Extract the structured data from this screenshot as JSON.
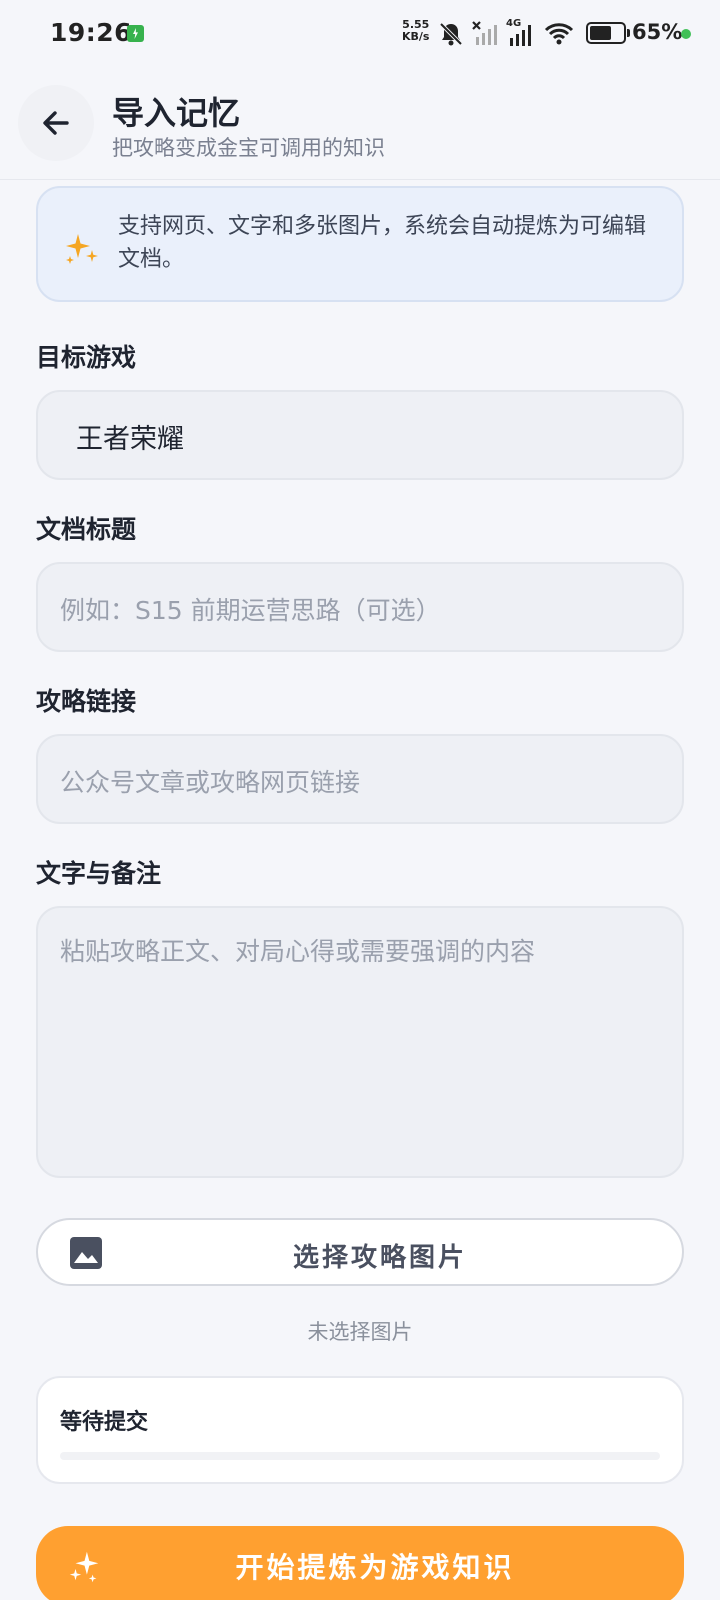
{
  "status_bar": {
    "time": "19:26",
    "net_speed_value": "5.55",
    "net_speed_unit": "KB/s",
    "network_type": "4G",
    "battery_percent": "65%",
    "battery_level": 0.65
  },
  "header": {
    "title": "导入记忆",
    "subtitle": "把攻略变成金宝可调用的知识"
  },
  "banner": {
    "text": "支持网页、文字和多张图片，系统会自动提炼为可编辑文档。",
    "icon": "sparkle-icon"
  },
  "form": {
    "game": {
      "label": "目标游戏",
      "value": "王者荣耀"
    },
    "doc_title": {
      "label": "文档标题",
      "placeholder": "例如：S15 前期运营思路（可选）"
    },
    "link": {
      "label": "攻略链接",
      "placeholder": "公众号文章或攻略网页链接"
    },
    "notes": {
      "label": "文字与备注",
      "placeholder": "粘贴攻略正文、对局心得或需要强调的内容"
    }
  },
  "image_select": {
    "button_label": "选择攻略图片",
    "icon": "image-icon",
    "status": "未选择图片"
  },
  "progress": {
    "title": "等待提交",
    "fraction": 0
  },
  "submit": {
    "label": "开始提炼为游戏知识",
    "icon": "sparkle-icon"
  },
  "colors": {
    "accent": "#ffa030",
    "banner_bg": "#eaf0fb",
    "sparkle": "#f5a623"
  }
}
